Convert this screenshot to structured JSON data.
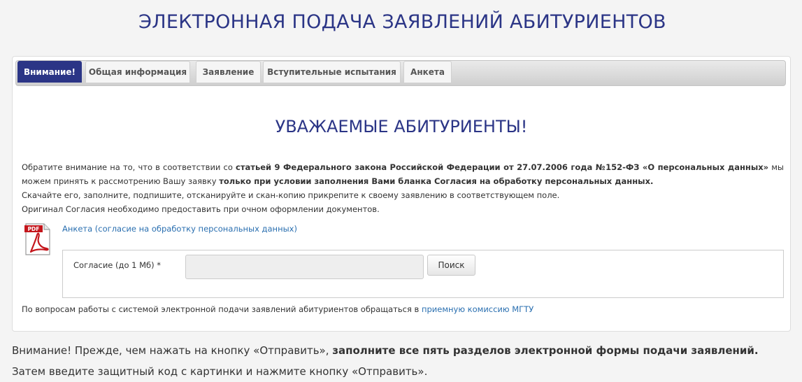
{
  "page": {
    "title": "ЭЛЕКТРОННАЯ ПОДАЧА ЗАЯВЛЕНИЙ АБИТУРИЕНТОВ"
  },
  "tabs": [
    {
      "label": "Внимание!",
      "active": true
    },
    {
      "label": "Общая информация",
      "active": false
    },
    {
      "label": "Заявление",
      "active": false
    },
    {
      "label": "Вступительные испытания",
      "active": false
    },
    {
      "label": "Анкета",
      "active": false
    }
  ],
  "content": {
    "heading": "УВАЖАЕМЫЕ АБИТУРИЕНТЫ!",
    "notice": {
      "p1_part1": "Обратите внимание на то, что в соответствии со ",
      "p1_bold1": "статьей 9 Федерального закона Российской Федерации от 27.07.2006 года №152-ФЗ «О персональных данных»",
      "p1_part2": " мы можем принять к рассмотрению Вашу заявку ",
      "p1_bold2": "только при условии заполнения Вами бланка Согласия на обработку персональных данных.",
      "p2": "Скачайте его, заполните, подпишите, отсканируйте и скан-копию прикрепите к своему заявлению в соответствующем поле.",
      "p3": "Оригинал Согласия необходимо предоставить при очном оформлении документов."
    },
    "pdf": {
      "icon_label": "PDF",
      "link_text": "Анкета (согласие на обработку персональных данных)"
    },
    "upload": {
      "label": "Согласие (до 1 Мб) *",
      "value": "",
      "button_label": "Поиск"
    },
    "contact": {
      "text": "По вопросам работы с системой электронной подачи заявлений абитуриентов обращаться в ",
      "link_text": "приемную комиссию МГТУ"
    }
  },
  "footer_note": {
    "line1_part1": "Внимание! Прежде, чем нажать на кнопку «Отправить», ",
    "line1_bold": "заполните все пять разделов электронной формы подачи заявлений.",
    "line2": "Затем введите защитный код с картинки и нажмите кнопку «Отправить»."
  },
  "colors": {
    "accent": "#2b3586",
    "link": "#2a6fb0",
    "pdf_red": "#c4161c"
  },
  "icons": {
    "pdf": "pdf-file-icon"
  }
}
